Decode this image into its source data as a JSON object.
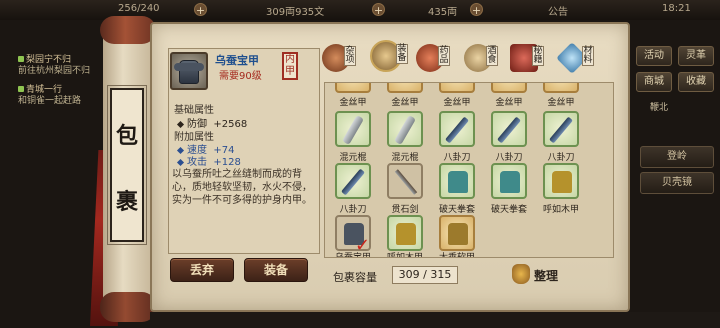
{
  "topbar": {
    "stat1": "256/240",
    "stat2": "309両935文",
    "stat3": "435両",
    "notice": "公告",
    "time": "18:21"
  },
  "quests": [
    {
      "title": "梨园宁不归",
      "sub": "前往杭州梨园不归"
    },
    {
      "title": "青城一行",
      "sub": "和铜雀一起赶路"
    }
  ],
  "right_menu": {
    "buttons": [
      "活动",
      "灵革",
      "商城",
      "收藏"
    ],
    "status": "鞭北",
    "wide_buttons": [
      "登岭",
      "贝壳镜"
    ]
  },
  "scroll": {
    "title_chars": [
      "包",
      "裹"
    ]
  },
  "item_detail": {
    "name": "乌蚕宝甲",
    "requirement": "需要90级",
    "tag": "内甲",
    "base_title": "基础属性",
    "base_attrs": [
      {
        "label": "防御",
        "value": "+2568"
      }
    ],
    "extra_title": "附加属性",
    "extra_attrs": [
      {
        "label": "速度",
        "value": "+74"
      },
      {
        "label": "攻击",
        "value": "+128"
      }
    ],
    "description": "以乌蚕所吐之丝缝制而成的背心，质地轻软坚韧，水火不侵，实为一件不可多得的护身内甲。"
  },
  "actions": {
    "discard": "丢弃",
    "equip": "装备"
  },
  "tabs": [
    {
      "label": "杂项",
      "icon": "pot-icon",
      "color": "#b0623a"
    },
    {
      "label": "装备",
      "icon": "helmet-icon",
      "color": "#c09a5a"
    },
    {
      "label": "药品",
      "icon": "gourd-icon",
      "color": "#c65a3c"
    },
    {
      "label": "酒食",
      "icon": "food-icon",
      "color": "#c0a772"
    },
    {
      "label": "秘籍",
      "icon": "book-icon",
      "color": "#b03b30"
    },
    {
      "label": "材料",
      "icon": "crystal-icon",
      "color": "#6aa8d4"
    }
  ],
  "inventory": {
    "rows": [
      [
        "金丝甲",
        "金丝甲",
        "金丝甲",
        "金丝甲",
        "金丝甲"
      ],
      [
        "混元棍",
        "混元棍",
        "八卦刀",
        "八卦刀",
        "八卦刀"
      ],
      [
        "八卦刀",
        "贯石剑",
        "破天拳套",
        "破天拳套",
        "呼如木甲"
      ],
      [
        "乌蚕宝甲",
        "呼如木甲",
        "大乘软甲"
      ]
    ]
  },
  "capacity": {
    "label": "包裹容量",
    "value": "309 / 315"
  },
  "sort_label": "整理"
}
